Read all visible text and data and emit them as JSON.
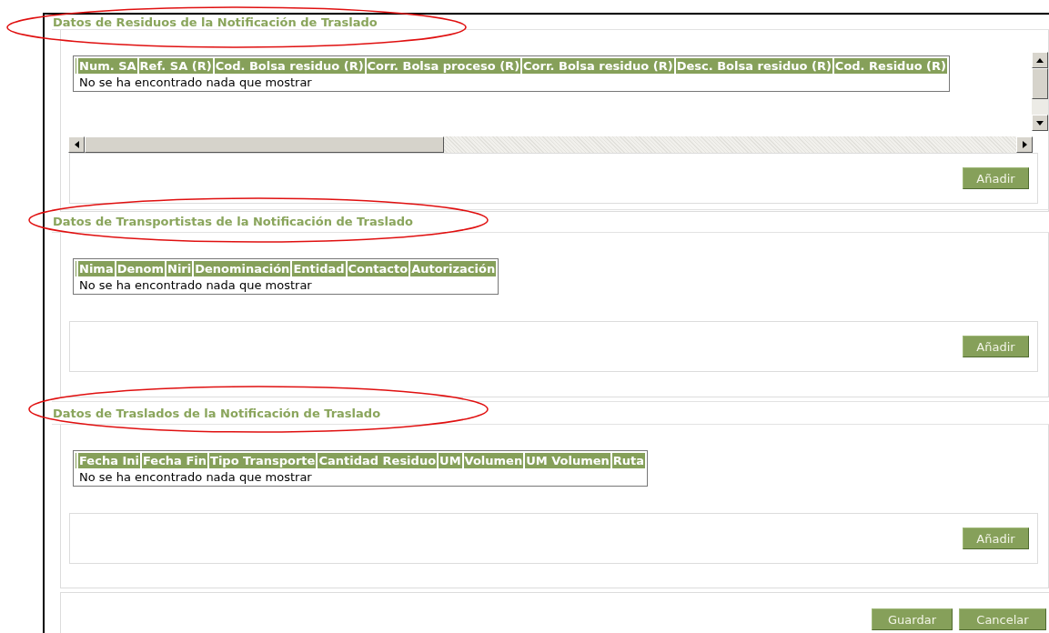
{
  "sections": [
    {
      "title": "Datos de Residuos de la Notificación de Traslado",
      "scrollable": true,
      "columns": [
        "Num. SA",
        "Ref. SA (R)",
        "Cod. Bolsa residuo (R)",
        "Corr. Bolsa proceso (R)",
        "Corr. Bolsa residuo (R)",
        "Desc. Bolsa residuo (R)",
        "Cod. Residuo (R)"
      ],
      "empty_message": "No se ha encontrado nada que mostrar",
      "add_button": "Añadir"
    },
    {
      "title": "Datos de Transportistas de la Notificación de Traslado",
      "scrollable": false,
      "columns": [
        "Nima",
        "Denom",
        "Niri",
        "Denominación",
        "Entidad",
        "Contacto",
        "Autorización"
      ],
      "empty_message": "No se ha encontrado nada que mostrar",
      "add_button": "Añadir"
    },
    {
      "title": "Datos de Traslados de la Notificación de Traslado",
      "scrollable": false,
      "columns": [
        "Fecha Ini",
        "Fecha Fin",
        "Tipo Transporte",
        "Cantidad Residuo",
        "UM",
        "Volumen",
        "UM Volumen",
        "Ruta"
      ],
      "empty_message": "No se ha encontrado nada que mostrar",
      "add_button": "Añadir"
    }
  ],
  "footer": {
    "buttons": [
      "Guardar",
      "Cancelar"
    ]
  }
}
